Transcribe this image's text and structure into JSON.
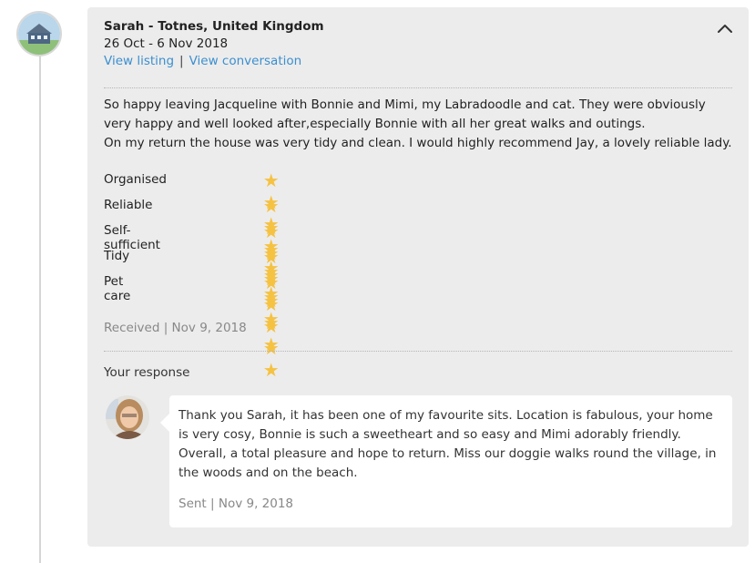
{
  "review": {
    "reviewer": "Sarah - Totnes, United Kingdom",
    "dates": "26 Oct - 6 Nov 2018",
    "view_listing": "View listing",
    "separator": "|",
    "view_conversation": "View conversation",
    "text_line1": "So happy leaving Jacqueline with Bonnie and Mimi, my Labradoodle and cat. They were obviously very happy and well looked after,especially Bonnie with all her great walks and outings.",
    "text_line2": "On my return the house was very tidy and clean. I would highly recommend Jay, a lovely reliable lady.",
    "received": "Received | Nov 9, 2018"
  },
  "ratings": [
    {
      "label": "Organised",
      "stars": 5
    },
    {
      "label": "Reliable",
      "stars": 5
    },
    {
      "label": "Self-sufficient",
      "stars": 5
    },
    {
      "label": "Tidy",
      "stars": 5
    },
    {
      "label": "Pet care",
      "stars": 5
    }
  ],
  "response": {
    "label": "Your response",
    "text": "Thank you Sarah, it has been one of my favourite sits. Location is fabulous, your home is very cosy, Bonnie is such a sweetheart and so easy and Mimi adorably friendly. Overall, a total pleasure and hope to return. Miss our doggie walks round the village, in the woods and on the beach.",
    "sent": "Sent | Nov 9, 2018"
  },
  "colors": {
    "card_bg": "#ececec",
    "link": "#3b8fd0",
    "star": "#f5c242",
    "muted_text": "#888888"
  },
  "icons": {
    "reviewer_avatar": "house-photo-avatar",
    "collapse": "chevron-up-icon",
    "rating_star": "star-icon",
    "response_avatar": "user-photo-avatar"
  }
}
